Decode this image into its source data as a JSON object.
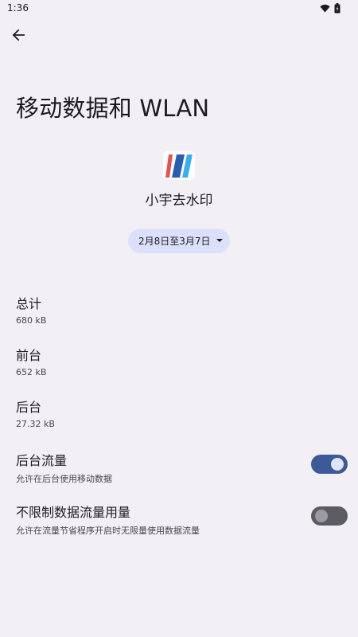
{
  "status_bar": {
    "time": "1:36",
    "icons": [
      "wifi-icon",
      "battery-icon"
    ]
  },
  "header": {
    "back_icon": "arrow-left-icon",
    "title": "移动数据和 WLAN"
  },
  "app": {
    "icon": "app-icon",
    "name": "小宇去水印"
  },
  "date_range": {
    "label": "2月8日至3月7日",
    "icon": "dropdown-arrow-icon"
  },
  "stats": [
    {
      "title": "总计",
      "value": "680 kB"
    },
    {
      "title": "前台",
      "value": "652 kB"
    },
    {
      "title": "后台",
      "value": "27.32 kB"
    }
  ],
  "toggles": [
    {
      "title": "后台流量",
      "subtitle": "允许在后台使用移动数据",
      "on": true
    },
    {
      "title": "不限制数据流量用量",
      "subtitle": "允许在流量节省程序开启时无限量使用数据流量",
      "on": false
    }
  ],
  "colors": {
    "background": "#f2f0f5",
    "accent": "#3d5a98",
    "pill": "#dbe1fa"
  }
}
